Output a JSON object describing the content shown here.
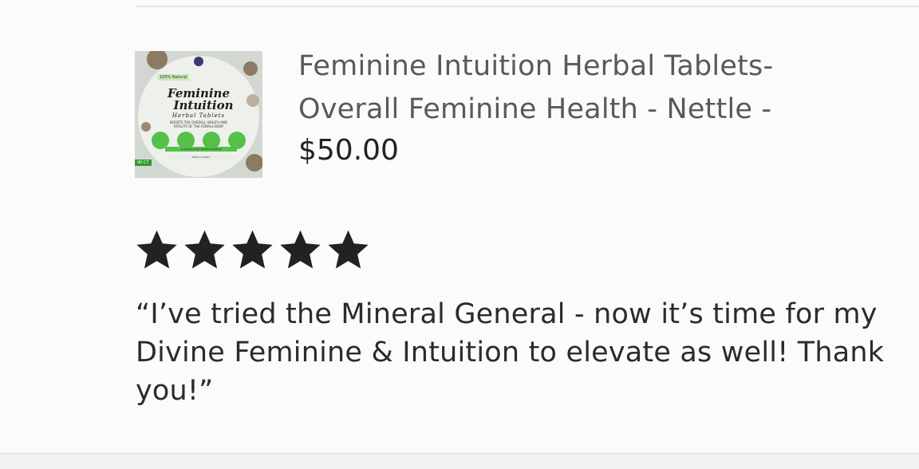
{
  "listing": {
    "thumbnail": {
      "icon": "product-package-image",
      "badge": "100% Natural",
      "title_line1": "Feminine",
      "title_line2": "Intuition",
      "subtitle": "Herbal Tablets",
      "description_line1": "BOOSTS THE OVERALL HEALTH AND",
      "description_line2": "VITALITY OF THE FEMALE BODY",
      "ribbon": "90 CT",
      "strip1": "ALKALINE PLANT BASED FORMULA",
      "strip2": "TAKE 2-3 DAILY",
      "accent_color": "#54c24a"
    },
    "title": "Feminine Intuition Herbal Tablets- Overall Feminine Health - Nettle -",
    "price": "$50.00"
  },
  "review": {
    "rating": 5,
    "max_rating": 5,
    "star_icon": "filled-star",
    "star_color": "#222222",
    "text": "“I’ve tried the Mineral General - now it’s time for my Divine Feminine & Intuition to elevate as well!  Thank you!”"
  }
}
